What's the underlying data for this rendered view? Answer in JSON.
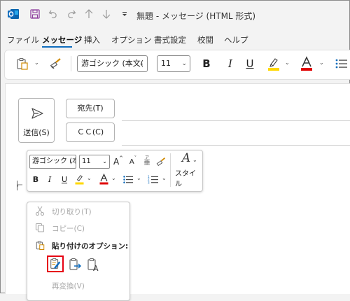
{
  "window": {
    "title": "無題 - メッセージ (HTML 形式)",
    "accent": "#0f6cbd"
  },
  "quick_access": {
    "icons": [
      "outlook-icon",
      "save-icon",
      "undo-icon",
      "redo-icon",
      "up-arrow-icon",
      "down-arrow-icon",
      "customize-icon"
    ]
  },
  "menu": {
    "tabs": [
      {
        "label": "ファイル"
      },
      {
        "label": "メッセージ",
        "active": true
      },
      {
        "label": "挿入"
      },
      {
        "label": "オプション"
      },
      {
        "label": "書式設定"
      },
      {
        "label": "校閲"
      },
      {
        "label": "ヘルプ"
      }
    ]
  },
  "ribbon": {
    "font_name": "游ゴシック (本文(",
    "font_size": "11",
    "bold": "B",
    "italic": "I",
    "underline": "U",
    "highlight_color": "#ffd800",
    "font_color": "#e00000"
  },
  "compose": {
    "send_label": "送信(S)",
    "to_label": "宛先(T)",
    "cc_label": "ＣＣ(C)"
  },
  "mini_toolbar": {
    "font_name": "游ゴシック (本",
    "font_size": "11",
    "grow_font": "A",
    "shrink_font": "A",
    "phonetic_ruby": "ア",
    "phonetic_base": "亜",
    "bold": "B",
    "italic": "I",
    "underline": "U",
    "style_letter": "A",
    "styles_label": "スタイル"
  },
  "context_menu": {
    "cut": "切り取り(T)",
    "copy": "コピー(C)",
    "paste_options": "貼り付けのオプション:",
    "reconvert": "再変換(V)",
    "paste_option_letter": "A",
    "selected_paste_highlight": "#e60012"
  }
}
